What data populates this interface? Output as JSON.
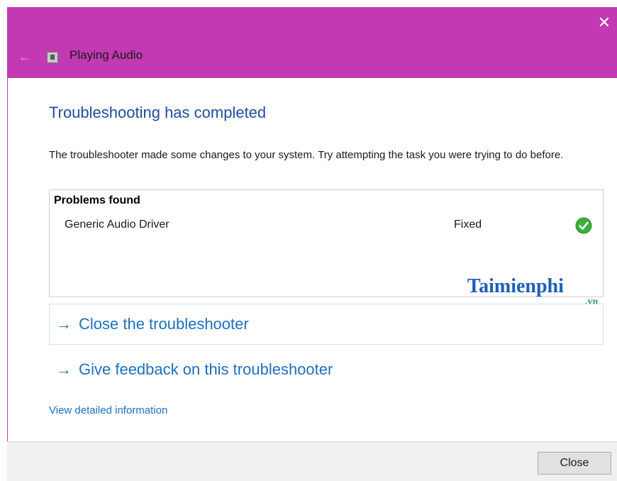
{
  "window": {
    "title": "Playing Audio",
    "accent_color": "#c239b3"
  },
  "icons": {
    "back": "arrow-left-icon",
    "app": "troubleshooter-icon",
    "close": "close-icon",
    "check": "check-circle-icon",
    "link_arrow": "arrow-right-icon"
  },
  "main": {
    "heading": "Troubleshooting has completed",
    "description": "The troubleshooter made some changes to your system. Try attempting the task you were trying to do before.",
    "problems": {
      "header": "Problems found",
      "items": [
        {
          "name": "Generic Audio Driver",
          "status": "Fixed"
        }
      ]
    },
    "links": {
      "close_label": "Close the troubleshooter",
      "feedback_label": "Give feedback on this troubleshooter",
      "details_label": "View detailed information"
    }
  },
  "watermark": {
    "main": "Taimienphi",
    "suffix": ".vn"
  },
  "footer": {
    "close_button": "Close"
  }
}
